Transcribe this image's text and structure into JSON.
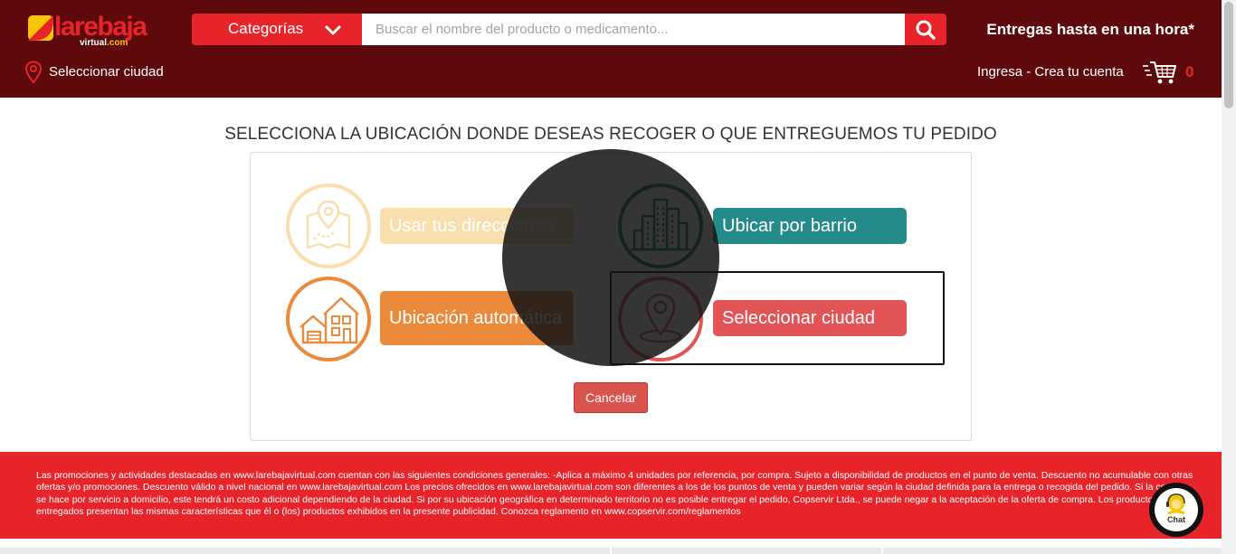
{
  "brand": {
    "name": "larebaja",
    "subtitle_main": "virtual",
    "subtitle_suffix": ".com"
  },
  "header": {
    "categories_label": "Categorías",
    "search_placeholder": "Buscar el nombre del producto o medicamento...",
    "delivery_text": "Entregas hasta en una hora*",
    "city_link": "Seleccionar ciudad",
    "account_link": "Ingresa - Crea tu cuenta",
    "cart_count": "0"
  },
  "main": {
    "title": "SELECCIONA LA UBICACIÓN DONDE DESEAS RECOGER O QUE ENTREGUEMOS TU PEDIDO",
    "options": [
      {
        "label": "Usar tus direcciones",
        "icon": "map-pin-icon",
        "color": "#f8dfad"
      },
      {
        "label": "Ubicar por barrio",
        "icon": "city-buildings-icon",
        "color": "#248b8a"
      },
      {
        "label": "Ubicación automática",
        "icon": "house-icon",
        "color": "#ec8a3b"
      },
      {
        "label": "Seleccionar ciudad",
        "icon": "location-pin-icon",
        "color": "#e35457"
      }
    ],
    "cancel_label": "Cancelar"
  },
  "footer": {
    "legal": "Las promociones y actividades destacadas en www.larebajavirtual.com cuentan con las siguientes condiciones generales: -Aplica a máximo 4 unidades por referencia, por compra. Sujeto a disponibilidad de productos en el punto de venta. Descuento no acumulable con otras ofertas y/o promociones. Descuento válido a nivel nacional en www.larebajavirtual.com Los precios ofrecidos en www.larebajavirtual.com son diferentes a los de los puntos de venta y pueden variar según la ciudad definida para la entrega o recogida del pedido. Si la compra se hace por servicio a domicilio, este tendrá un costo adicional dependiendo de la ciudad. Si por su ubicación geográfica en determinado territorio no es posible entregar el pedido, Copservir Ltda., se puede negar a la aceptación de la oferta de compra. Los productos entregados presentan las mismas características que él o (los) productos exhibidos en la presente publicidad. Conozca reglamento en www.copservir.com/reglamentos"
  },
  "chat": {
    "label": "Chat"
  },
  "colors": {
    "header_bg": "#5e0a0c",
    "brand_red": "#e8242b",
    "brand_yellow": "#f7c600"
  }
}
